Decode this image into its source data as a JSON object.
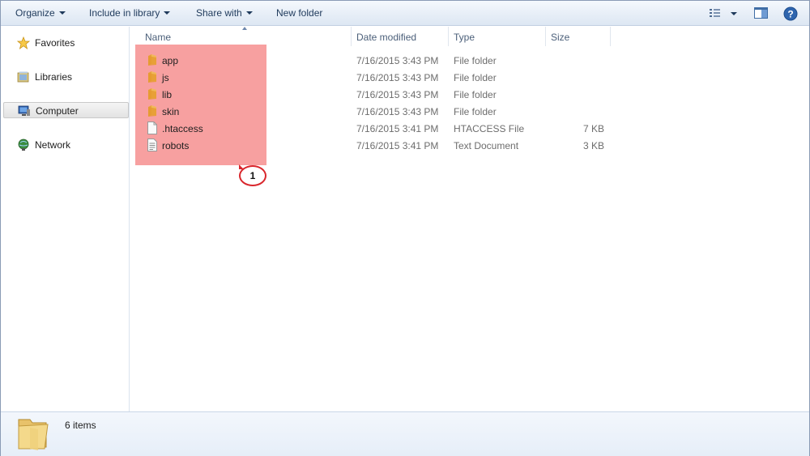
{
  "toolbar": {
    "organize": "Organize",
    "include_in_library": "Include in library",
    "share_with": "Share with",
    "new_folder": "New folder",
    "icons": [
      "views-icon",
      "preview-pane-icon",
      "help-icon"
    ]
  },
  "nav": {
    "items": [
      {
        "label": "Favorites",
        "icon": "star-icon"
      },
      {
        "label": "Libraries",
        "icon": "libraries-icon"
      },
      {
        "label": "Computer",
        "icon": "computer-icon",
        "selected": true
      },
      {
        "label": "Network",
        "icon": "network-icon"
      }
    ]
  },
  "columns": {
    "name": "Name",
    "date_modified": "Date modified",
    "type": "Type",
    "size": "Size"
  },
  "files": [
    {
      "name": "app",
      "date": "7/16/2015 3:43 PM",
      "type": "File folder",
      "size": "",
      "icon": "folder-icon"
    },
    {
      "name": "js",
      "date": "7/16/2015 3:43 PM",
      "type": "File folder",
      "size": "",
      "icon": "folder-icon"
    },
    {
      "name": "lib",
      "date": "7/16/2015 3:43 PM",
      "type": "File folder",
      "size": "",
      "icon": "folder-icon"
    },
    {
      "name": "skin",
      "date": "7/16/2015 3:43 PM",
      "type": "File folder",
      "size": "",
      "icon": "folder-icon"
    },
    {
      "name": ".htaccess",
      "date": "7/16/2015 3:41 PM",
      "type": "HTACCESS File",
      "size": "7 KB",
      "icon": "file-icon"
    },
    {
      "name": "robots",
      "date": "7/16/2015 3:41 PM",
      "type": "Text Document",
      "size": "3 KB",
      "icon": "text-file-icon"
    }
  ],
  "annotation": {
    "number": "1",
    "highlight_color": "#f79b9b",
    "callout_color": "#d9262c"
  },
  "details": {
    "count": "6 items"
  }
}
